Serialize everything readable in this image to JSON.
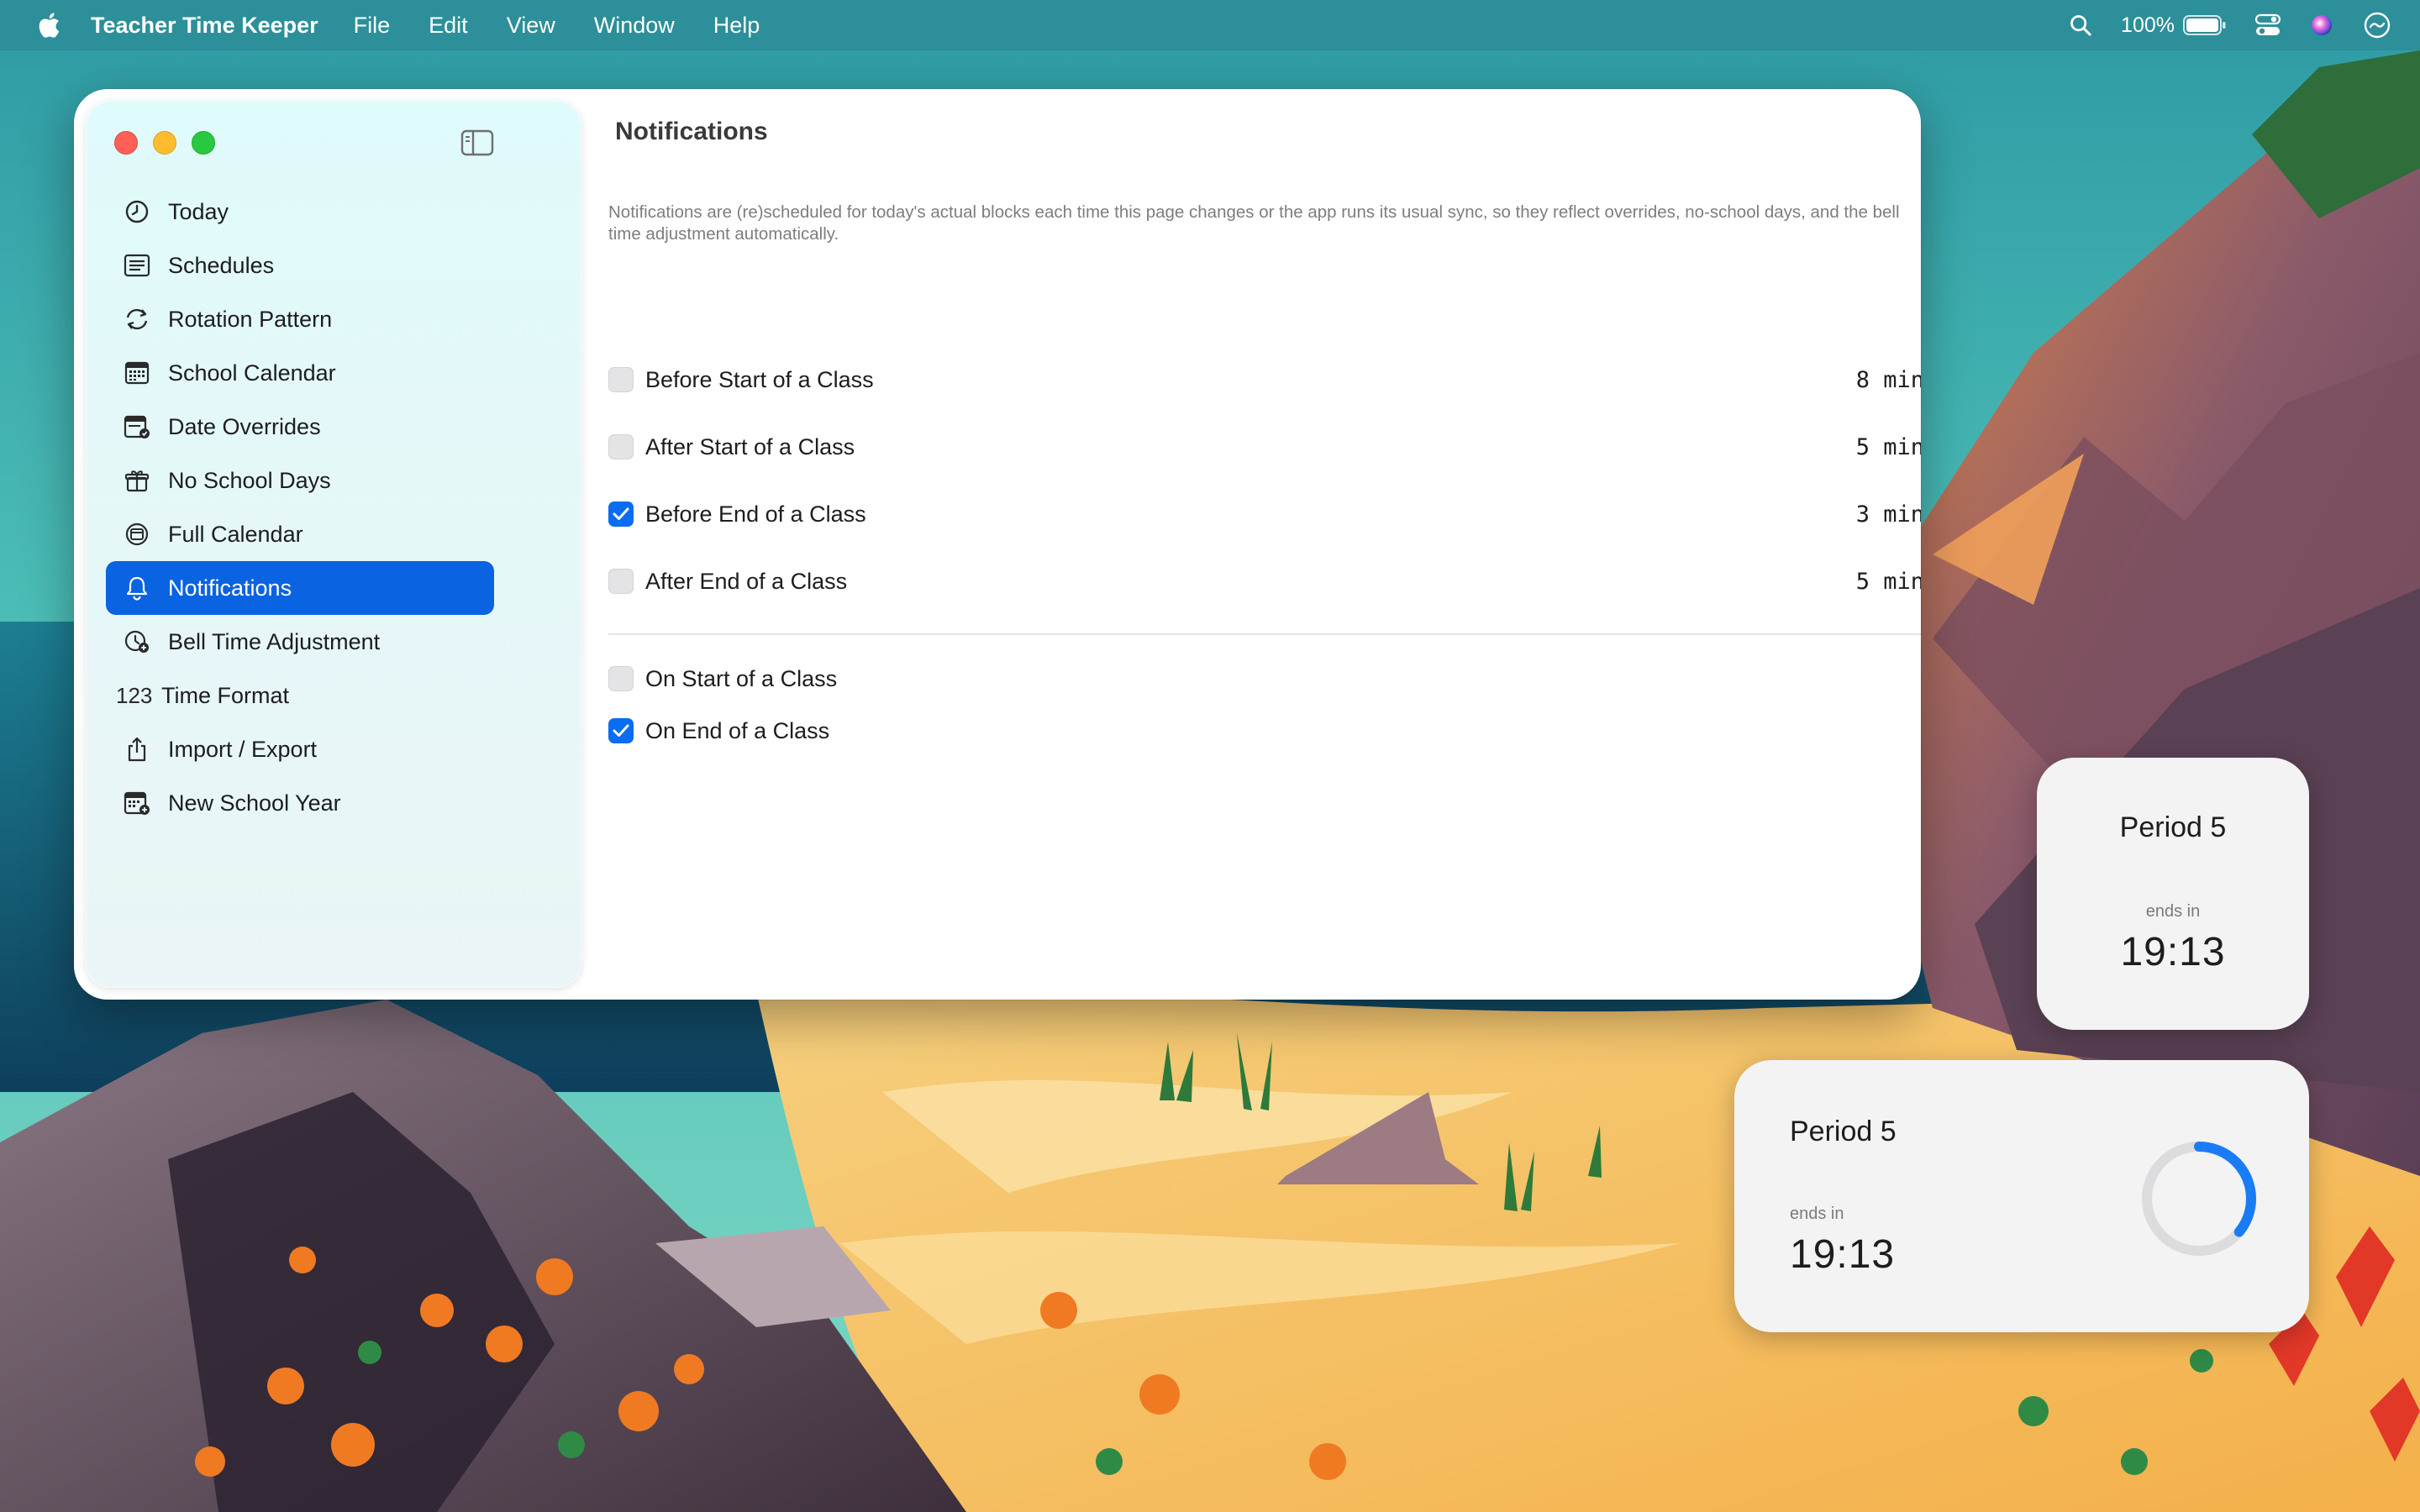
{
  "menubar": {
    "app_name": "Teacher Time Keeper",
    "menus": [
      "File",
      "Edit",
      "View",
      "Window",
      "Help"
    ],
    "battery": "100%",
    "icons": [
      "apple-icon",
      "search-icon",
      "battery-icon",
      "control-center-icon",
      "siri-icon",
      "clock-icon"
    ]
  },
  "sidebar": {
    "items": [
      {
        "label": "Today",
        "icon": "clock-icon"
      },
      {
        "label": "Schedules",
        "icon": "list-icon"
      },
      {
        "label": "Rotation Pattern",
        "icon": "rotation-icon"
      },
      {
        "label": "School Calendar",
        "icon": "calendar-icon"
      },
      {
        "label": "Date Overrides",
        "icon": "calendar-edit-icon"
      },
      {
        "label": "No School Days",
        "icon": "gift-icon"
      },
      {
        "label": "Full Calendar",
        "icon": "calendar-circle-icon"
      },
      {
        "label": "Notifications",
        "icon": "bell-icon",
        "selected": true
      },
      {
        "label": "Bell Time Adjustment",
        "icon": "clock-adjust-icon"
      },
      {
        "label": "Time Format",
        "icon": "number-icon",
        "icon_text": "123"
      },
      {
        "label": "Import / Export",
        "icon": "share-icon"
      },
      {
        "label": "New School Year",
        "icon": "calendar-add-icon"
      }
    ]
  },
  "page": {
    "title": "Notifications",
    "description": "Notifications are (re)scheduled for today's actual blocks each time this page changes or the app runs its usual sync, so they reflect overrides, no-school days, and the bell time adjustment automatically.",
    "timed_options": [
      {
        "label": "Before Start of a Class",
        "value": "8 min",
        "checked": false
      },
      {
        "label": "After Start of a Class",
        "value": "5 min",
        "checked": false
      },
      {
        "label": "Before End of a Class",
        "value": "3 min",
        "checked": true
      },
      {
        "label": "After End of a Class",
        "value": "5 min",
        "checked": false
      }
    ],
    "instant_options": [
      {
        "label": "On Start of a Class",
        "checked": false
      },
      {
        "label": "On End of a Class",
        "checked": true
      }
    ]
  },
  "widgets": {
    "small": {
      "title": "Period 5",
      "ends_label": "ends in",
      "time": "19:13"
    },
    "medium": {
      "title": "Period 5",
      "ends_label": "ends in",
      "time": "19:13",
      "progress": 0.36
    },
    "accent_color": "#1a7cf5"
  },
  "colors": {
    "accent": "#0a63e0",
    "checkbox_checked": "#0a6cf0"
  }
}
